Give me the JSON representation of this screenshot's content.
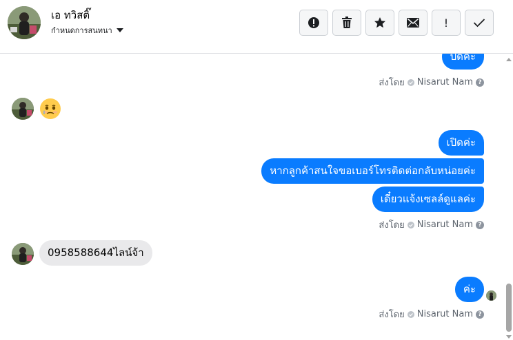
{
  "header": {
    "contact_name": "เอ ทวิสติ๊",
    "assign_label": "กำหนดการสนทนา",
    "actions": [
      {
        "icon": "alert-icon"
      },
      {
        "icon": "trash-icon"
      },
      {
        "icon": "star-icon"
      },
      {
        "icon": "mail-icon"
      },
      {
        "icon": "exclamation-icon",
        "glyph": "!"
      },
      {
        "icon": "checkmark-icon"
      }
    ]
  },
  "messages": {
    "out_top": "ปิดค่ะ",
    "sent_by_prefix": "ส่งโดย",
    "sent_by_name": "Nisarut Nam",
    "in_emoji_name": "face-holding-back-tears-emoji",
    "out_1": "เปิดค่ะ",
    "out_2": "หากลูกค้าสนใจขอเบอร์โทรติดต่อกลับหน่อยค่ะ",
    "out_3": "เดี๋ยวแจ้งเซลล์ดูแลค่ะ",
    "in_phone": "0958588644ไลน์จ้า",
    "out_4": "ค่ะ"
  },
  "colors": {
    "outgoing_bubble": "#0a7cff",
    "incoming_bubble": "#e9e9eb",
    "meta_text": "#606770"
  }
}
